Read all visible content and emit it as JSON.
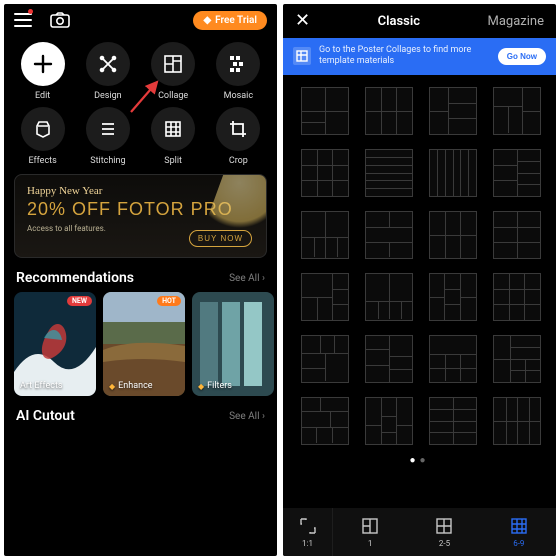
{
  "left": {
    "freeTrial": "Free Trial",
    "tools": [
      {
        "key": "edit",
        "label": "Edit"
      },
      {
        "key": "design",
        "label": "Design"
      },
      {
        "key": "collage",
        "label": "Collage"
      },
      {
        "key": "mosaic",
        "label": "Mosaic"
      },
      {
        "key": "effects",
        "label": "Effects"
      },
      {
        "key": "stitching",
        "label": "Stitching"
      },
      {
        "key": "split",
        "label": "Split"
      },
      {
        "key": "crop",
        "label": "Crop"
      }
    ],
    "promo": {
      "greeting": "Happy New Year",
      "headline": "20% OFF FOTOR PRO",
      "sub": "Access to all features.",
      "cta": "BUY NOW"
    },
    "sections": {
      "recs": {
        "title": "Recommendations",
        "see": "See All  ›"
      },
      "ai": {
        "title": "AI Cutout",
        "see": "See All  ›"
      }
    },
    "cards": [
      {
        "label": "Art Effects",
        "badge": "NEW",
        "badgeType": "new"
      },
      {
        "label": "Enhance",
        "badge": "HOT",
        "badgeType": "hot",
        "premium": true
      },
      {
        "label": "Filters"
      }
    ]
  },
  "right": {
    "tabActive": "Classic",
    "tabOther": "Magazine",
    "banner": {
      "text": "Go to the Poster Collages to find more template materials",
      "cta": "Go Now"
    },
    "ratio": "1:1",
    "bottom": [
      {
        "label": "1"
      },
      {
        "label": "2-5"
      },
      {
        "label": "6-9",
        "active": true
      }
    ]
  }
}
